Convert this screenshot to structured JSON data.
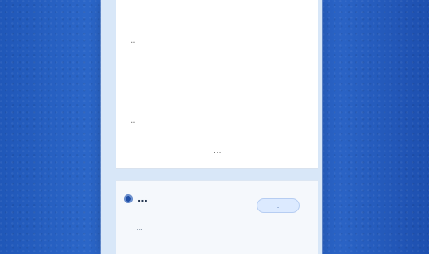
{
  "article": {
    "paragraph1": "...",
    "paragraph2": "...",
    "read_more": "..."
  },
  "event": {
    "title": "...",
    "subtitle": "...",
    "badge": "...",
    "description": "..."
  }
}
